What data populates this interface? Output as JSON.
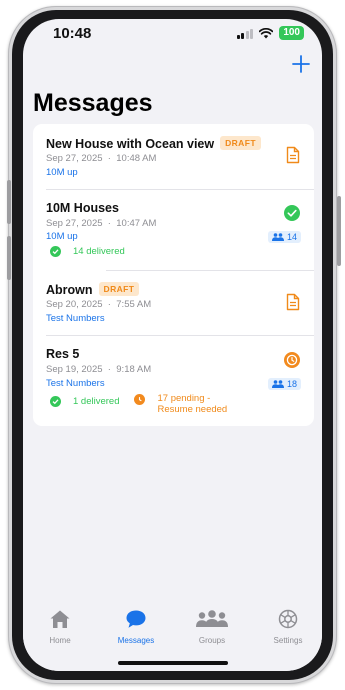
{
  "status_bar": {
    "time": "10:48",
    "battery": "100"
  },
  "header": {
    "title": "Messages"
  },
  "messages": [
    {
      "title": "New House with Ocean view",
      "badge": "DRAFT",
      "date": "Sep 27, 2025",
      "time": "10:48 AM",
      "group": "10M up",
      "status_icon": "document-icon"
    },
    {
      "title": "10M Houses",
      "date": "Sep 27, 2025",
      "time": "10:47 AM",
      "group": "10M up",
      "delivered": "14 delivered",
      "recipients": "14",
      "status_icon": "checkmark-circle-icon"
    },
    {
      "title": "Abrown",
      "badge": "DRAFT",
      "date": "Sep 20, 2025",
      "time": "7:55 AM",
      "group": "Test Numbers",
      "status_icon": "document-icon"
    },
    {
      "title": "Res 5",
      "date": "Sep 19, 2025",
      "time": "9:18 AM",
      "group": "Test Numbers",
      "delivered": "1 delivered",
      "pending_line1": "17 pending -",
      "pending_line2": "Resume needed",
      "recipients": "18",
      "status_icon": "clock-circle-icon"
    }
  ],
  "tabbar": {
    "tabs": [
      {
        "label": "Home",
        "icon": "house-icon"
      },
      {
        "label": "Messages",
        "icon": "chat-bubble-icon",
        "active": true
      },
      {
        "label": "Groups",
        "icon": "people-icon"
      },
      {
        "label": "Settings",
        "icon": "gear-icon"
      }
    ]
  },
  "colors": {
    "accent": "#1a73e8",
    "success": "#34c759",
    "warning": "#f08a1a",
    "background": "#f2f2f6"
  }
}
